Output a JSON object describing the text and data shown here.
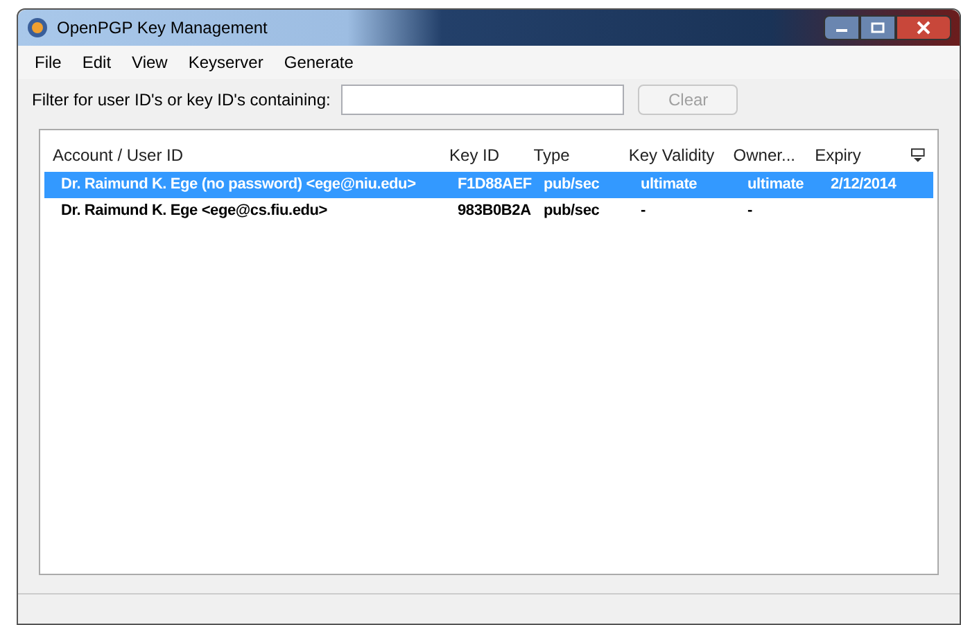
{
  "window": {
    "title": "OpenPGP Key Management"
  },
  "menu": [
    "File",
    "Edit",
    "View",
    "Keyserver",
    "Generate"
  ],
  "filter": {
    "label": "Filter for user ID's or key ID's containing:",
    "clear_button": {
      "label": "Clear",
      "disabled": true
    }
  },
  "table": {
    "columns": [
      "Account / User ID",
      "Key ID",
      "Type",
      "Key Validity",
      "Owner...",
      "Expiry"
    ],
    "rows": [
      {
        "selected": true,
        "cells": [
          "Dr. Raimund K. Ege (no password) <ege@niu.edu>",
          "F1D88AEF",
          "pub/sec",
          "ultimate",
          "ultimate",
          "2/12/2014"
        ]
      },
      {
        "selected": false,
        "cells": [
          "Dr. Raimund K. Ege <ege@cs.fiu.edu>",
          "983B0B2A",
          "pub/sec",
          "-",
          "-",
          ""
        ]
      }
    ]
  }
}
